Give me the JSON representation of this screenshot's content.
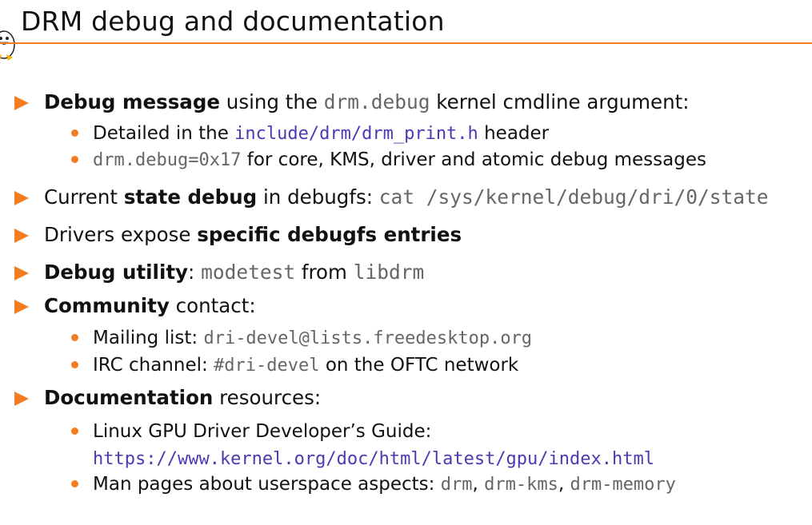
{
  "title": "DRM debug and documentation",
  "colors": {
    "accent": "#f57c1f",
    "code": "#666666",
    "link": "#4a3ab3"
  },
  "icons": {
    "logo": "penguin-icon",
    "bullet_level1": "orange-triangle",
    "bullet_level2": "orange-dot"
  },
  "bullets": [
    {
      "b": "Debug message",
      "t1": " using the ",
      "c": "drm.debug",
      "t2": " kernel cmdline argument:",
      "sub": [
        {
          "t1": "Detailed in the ",
          "l": "include/drm/drm_print.h",
          "t2": " header"
        },
        {
          "c": "drm.debug=0x17",
          "t2": " for core, KMS, driver and atomic debug messages"
        }
      ]
    },
    {
      "t0": "Current ",
      "b": "state debug",
      "t1": " in debugfs: ",
      "c": "cat /sys/kernel/debug/dri/0/state"
    },
    {
      "t0": "Drivers expose ",
      "b": "specific debugfs entries"
    },
    {
      "b": "Debug utility",
      "t1": ": ",
      "c1": "modetest",
      "t2": " from ",
      "c2": "libdrm"
    },
    {
      "b": "Community",
      "t1": " contact:",
      "sub": [
        {
          "t1": "Mailing list: ",
          "c": "dri-devel@lists.freedesktop.org"
        },
        {
          "t1": "IRC channel: ",
          "c": "#dri-devel",
          "t2": " on the OFTC network"
        }
      ]
    },
    {
      "b": "Documentation",
      "t1": " resources:",
      "sub": [
        {
          "t1": "Linux GPU Driver Developer’s Guide:",
          "l": "https://www.kernel.org/doc/html/latest/gpu/index.html"
        },
        {
          "t1": "Man pages about userspace aspects: ",
          "c1": "drm",
          "s1": ", ",
          "c2": "drm-kms",
          "s2": ", ",
          "c3": "drm-memory"
        }
      ]
    }
  ]
}
